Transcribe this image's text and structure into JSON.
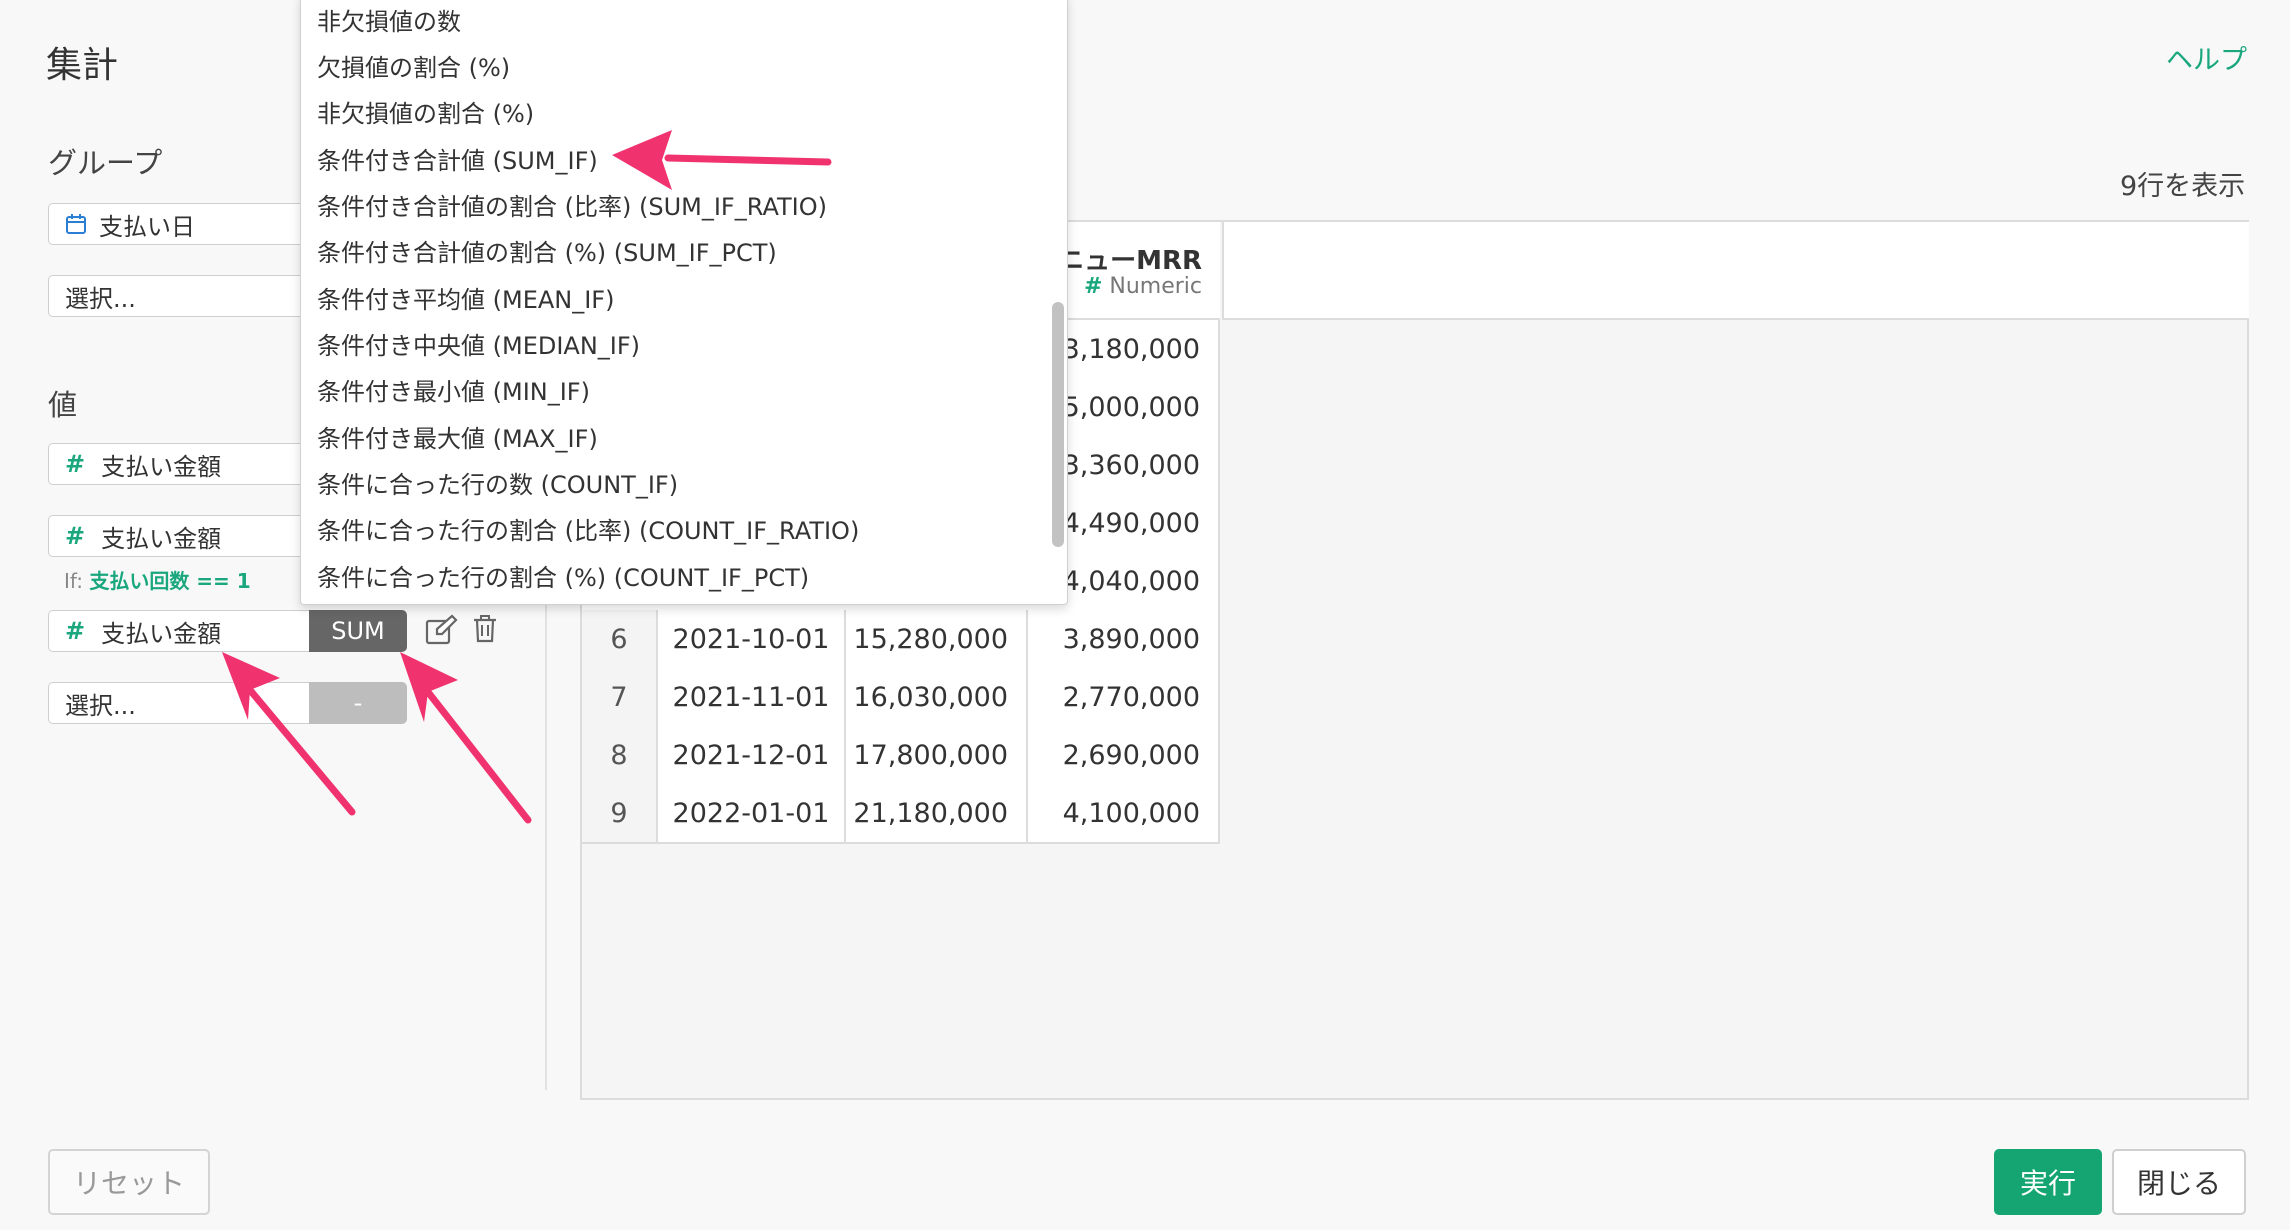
{
  "header": {
    "title": "集計",
    "help": "ヘルプ"
  },
  "left": {
    "group_label": "グループ",
    "group_field": "支払い日",
    "group_select_placeholder": "選択...",
    "value_label": "値",
    "values": [
      {
        "name": "支払い金額"
      },
      {
        "name": "支払い金額",
        "if_prefix": "If:",
        "if_condition": "支払い回数 == 1"
      },
      {
        "name": "支払い金額",
        "agg": "SUM"
      }
    ],
    "value_select_placeholder": "選択...",
    "value_select_agg": "-"
  },
  "dropdown": {
    "items": [
      "非欠損値の数",
      "欠損値の割合 (%)",
      "非欠損値の割合 (%)",
      "条件付き合計値 (SUM_IF)",
      "条件付き合計値の割合 (比率) (SUM_IF_RATIO)",
      "条件付き合計値の割合 (%) (SUM_IF_PCT)",
      "条件付き平均値 (MEAN_IF)",
      "条件付き中央値 (MEDIAN_IF)",
      "条件付き最小値 (MIN_IF)",
      "条件付き最大値 (MAX_IF)",
      "条件に合った行の数 (COUNT_IF)",
      "条件に合った行の割合 (比率) (COUNT_IF_RATIO)",
      "条件に合った行の割合 (%) (COUNT_IF_PCT)"
    ]
  },
  "table": {
    "rows_count": "9行を表示",
    "last_col_title": "ニューMRR",
    "last_col_type": "Numeric",
    "partial_values": [
      "3,180,000",
      "5,000,000",
      "3,360,000",
      "4,490,000",
      "4,040,000"
    ],
    "rows": [
      {
        "idx": "6",
        "date": "2021-10-01",
        "v1": "15,280,000",
        "v2": "3,890,000"
      },
      {
        "idx": "7",
        "date": "2021-11-01",
        "v1": "16,030,000",
        "v2": "2,770,000"
      },
      {
        "idx": "8",
        "date": "2021-12-01",
        "v1": "17,800,000",
        "v2": "2,690,000"
      },
      {
        "idx": "9",
        "date": "2022-01-01",
        "v1": "21,180,000",
        "v2": "4,100,000"
      }
    ]
  },
  "footer": {
    "reset": "リセット",
    "run": "実行",
    "close": "閉じる"
  },
  "colors": {
    "accent": "#1aa77e",
    "run_button": "#14a572",
    "arrow": "#f0336f",
    "agg_button": "#666666"
  },
  "icons": {
    "edit": "edit-icon",
    "delete": "trash-icon",
    "calendar": "calendar-icon"
  }
}
